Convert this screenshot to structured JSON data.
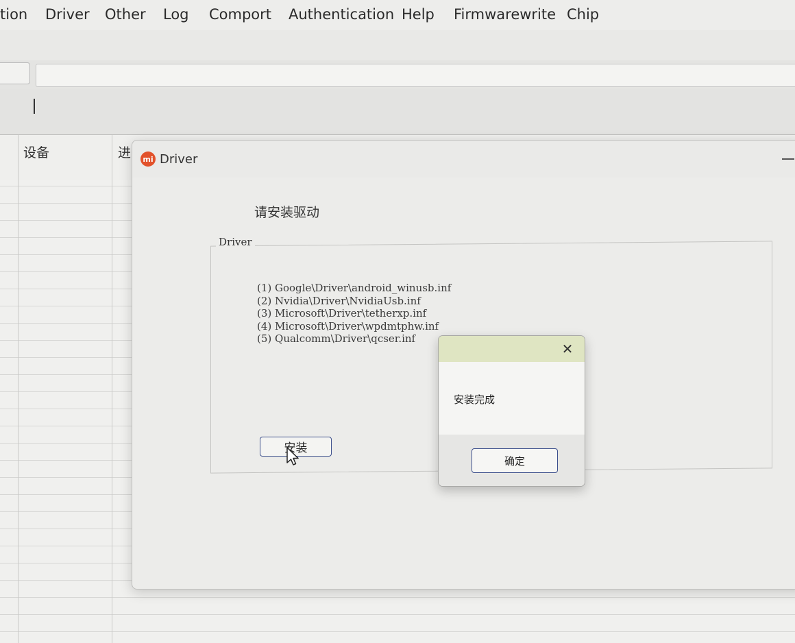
{
  "menu": {
    "items": [
      {
        "label": "tion"
      },
      {
        "label": "Driver"
      },
      {
        "label": "Other"
      },
      {
        "label": "Log"
      },
      {
        "label": "Comport"
      },
      {
        "label": "Authentication"
      },
      {
        "label": "Help"
      },
      {
        "label": "Firmwarewrite"
      },
      {
        "label": "Chip"
      }
    ]
  },
  "table": {
    "columns": [
      "设备",
      "进"
    ]
  },
  "driver_window": {
    "title": "Driver",
    "heading": "请安装驱动",
    "group_label": "Driver",
    "drivers": [
      "(1) Google\\Driver\\android_winusb.inf",
      "(2) Nvidia\\Driver\\NvidiaUsb.inf",
      "(3) Microsoft\\Driver\\tetherxp.inf",
      "(4) Microsoft\\Driver\\wpdmtphw.inf",
      "(5) Qualcomm\\Driver\\qcser.inf"
    ],
    "install_button": "安装"
  },
  "message_box": {
    "close_glyph": "✕",
    "message": "安装完成",
    "ok_button": "确定"
  },
  "icons": {
    "app_logo": "mi-logo-icon",
    "close": "close-icon",
    "cursor": "mouse-pointer-icon"
  },
  "colors": {
    "brand_logo": "#e2522b",
    "button_border": "#3c4f8c",
    "msgbox_titlebar": "#dfe5c2"
  }
}
